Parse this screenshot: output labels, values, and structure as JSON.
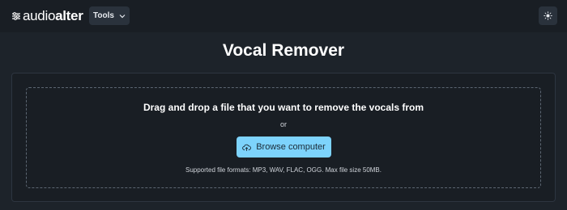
{
  "header": {
    "logo": {
      "icon": "sliders-icon",
      "text_light": "audio",
      "text_bold": "alter"
    },
    "tools_menu": {
      "label": "Tools",
      "icon": "chevron-down-icon"
    },
    "theme_toggle": {
      "icon": "sun-icon"
    }
  },
  "main": {
    "title": "Vocal Remover",
    "upload": {
      "heading": "Drag and drop a file that you want to remove the vocals from",
      "or_text": "or",
      "browse_button": {
        "label": "Browse computer",
        "icon": "cloud-upload-icon"
      },
      "formats_note": "Supported file formats: MP3, WAV, FLAC, OGG. Max file size 50MB."
    }
  },
  "colors": {
    "background": "#1d232a",
    "header_background": "#191e24",
    "card_background": "#191e24",
    "button_accent": "#7dd3fc",
    "dropzone_border": "#5c6672"
  }
}
